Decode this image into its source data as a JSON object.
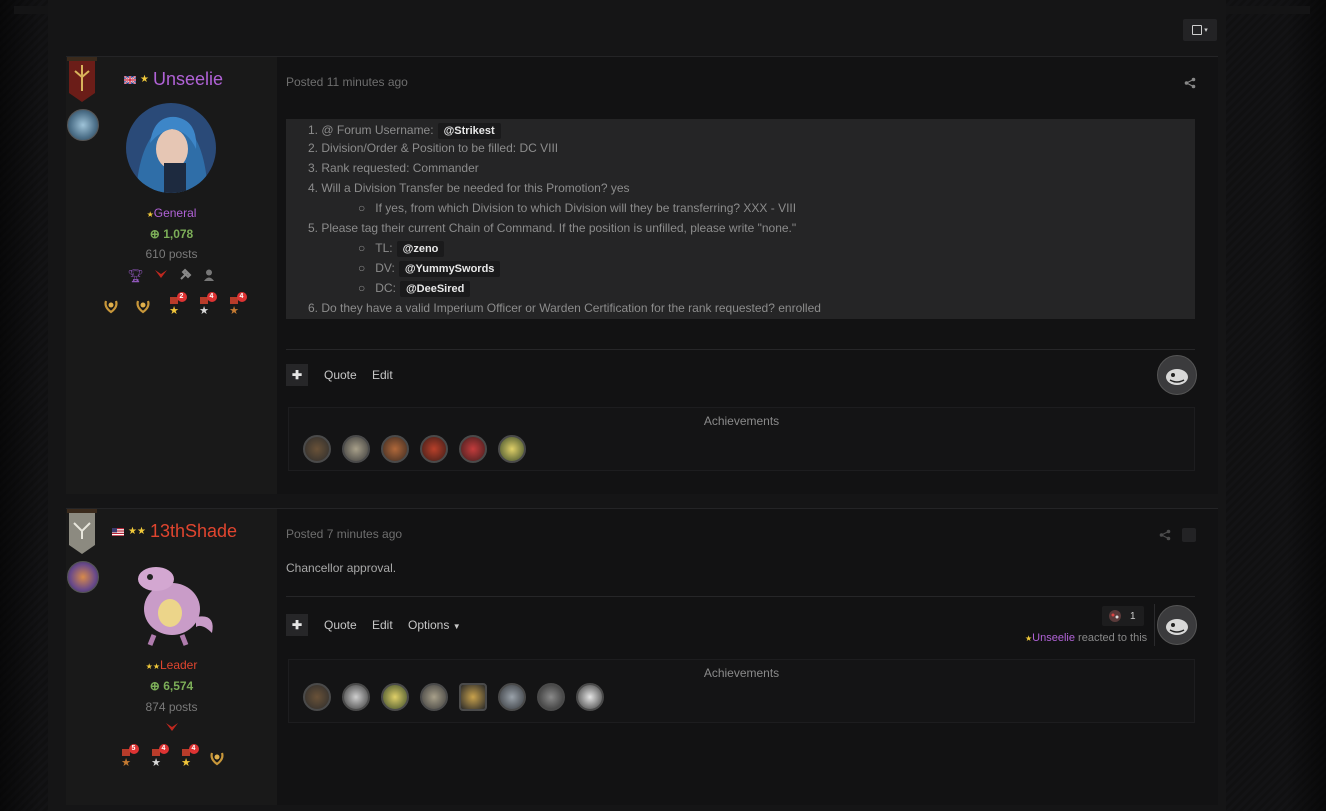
{
  "toolbar": {
    "mod_label": "▾"
  },
  "posts": [
    {
      "author": {
        "name": "Unseelie",
        "name_color": "#b062d6",
        "flag": "uk-flag",
        "stars": "★",
        "group": "General",
        "group_stars": "★",
        "group_color": "#b062d6",
        "reputation": "1,078",
        "post_count": "610 posts",
        "medal_counts": [
          "2",
          "4",
          "4"
        ]
      },
      "posted": "Posted 11 minutes ago",
      "quote_lines": [
        {
          "num": "1.",
          "text": "@ Forum Username:",
          "mention": "@Strikest"
        },
        {
          "num": "2.",
          "text": "Division/Order & Position to be filled: DC VIII"
        },
        {
          "num": "3.",
          "text": "Rank requested: Commander"
        },
        {
          "num": "4.",
          "text": "Will a Division Transfer be needed for this Promotion? yes"
        },
        {
          "num": "5.",
          "text": "Please tag their current Chain of Command. If the position is unfilled, please write \"none.\""
        },
        {
          "num": "6.",
          "text": "Do they have a valid Imperium Officer or Warden Certification for the rank requested? enrolled"
        }
      ],
      "sub_lines": [
        {
          "bullet": "○",
          "text": "If yes, from which Division to which Division will they be transferring? XXX - VIII"
        },
        {
          "bullet": "○",
          "text": "TL:",
          "mention": "@zeno"
        },
        {
          "bullet": "○",
          "text": "DV:",
          "mention": "@YummySwords"
        },
        {
          "bullet": "○",
          "text": "DC:",
          "mention": "@DeeSired"
        }
      ],
      "actions": {
        "plus": "✚",
        "quote": "Quote",
        "edit": "Edit"
      },
      "achievements_title": "Achievements"
    },
    {
      "author": {
        "name": "13thShade",
        "name_color": "#e0452f",
        "flag": "us-flag",
        "stars": "★★",
        "group": "Leader",
        "group_stars": "★★",
        "group_color": "#e0452f",
        "reputation": "6,574",
        "post_count": "874 posts",
        "medal_counts": [
          "5",
          "4",
          "4"
        ]
      },
      "posted": "Posted 7 minutes ago",
      "body": "Chancellor approval.",
      "actions": {
        "plus": "✚",
        "quote": "Quote",
        "edit": "Edit",
        "options": "Options"
      },
      "reaction": {
        "count": "1",
        "star": "★",
        "user": "Unseelie",
        "suffix": "reacted to this"
      },
      "achievements_title": "Achievements"
    }
  ]
}
